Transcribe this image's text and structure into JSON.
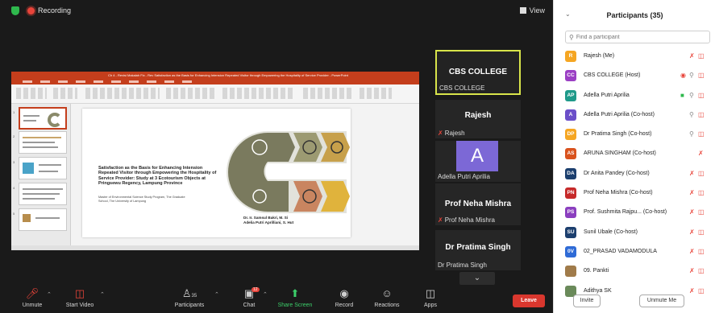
{
  "topbar": {
    "recording_label": "Recording",
    "view_label": "View"
  },
  "shared_screen": {
    "app_title": "Ch 4 - Revisi Makalah Fix - Rev Satisfaction as the Basis for Enhancing Intension Repeated Visitor through Empowering the Hospitality of Service Provider - PowerPoint",
    "slide_title": "Satisfaction as the Basis for Enhancing Intension Repeated Visitor through Empowering the Hospitality of Service Provider: Study at 3 Ecotourism Objects at Pringsewu Regency, Lampung Province",
    "slide_subtitle": "Master of Environmental Science Study Program, The Graduate School, The University of Lampung",
    "slide_authors": "Dr. Ir. Samsul Bakri, M. Si\nAdelia Putri Aprilliani, S. Hut"
  },
  "tiles": {
    "cbs": {
      "name": "CBS COLLEGE",
      "label": "CBS COLLEGE"
    },
    "rajesh": {
      "name": "Rajesh",
      "label": "Rajesh"
    },
    "adella": {
      "avatar": "A",
      "label": "Adella Putri Aprilia"
    },
    "neha": {
      "name": "Prof Neha Mishra",
      "label": "Prof Neha Mishra"
    },
    "pratima": {
      "name": "Dr Pratima Singh",
      "label": "Dr Pratima Singh"
    }
  },
  "toolbar": {
    "unmute": "Unmute",
    "start_video": "Start Video",
    "participants": "Participants",
    "participants_count": "35",
    "chat": "Chat",
    "chat_badge": "12",
    "share_screen": "Share Screen",
    "record": "Record",
    "reactions": "Reactions",
    "apps": "Apps",
    "leave": "Leave"
  },
  "panel": {
    "title": "Participants (35)",
    "search_placeholder": "Find a participant",
    "invite": "Invite",
    "unmute_me": "Unmute Me",
    "participants": [
      {
        "initials": "R",
        "color": "#f5a623",
        "name": "Rajesh (Me)",
        "icons": [
          "mic-off",
          "cam-off"
        ]
      },
      {
        "initials": "CC",
        "color": "#9b3fc4",
        "name": "CBS COLLEGE (Host)",
        "icons": [
          "share",
          "mic-on",
          "cam-off"
        ]
      },
      {
        "initials": "AP",
        "color": "#1f9a8a",
        "name": "Adella Putri Aprilia",
        "icons": [
          "cam-on",
          "mic-on",
          "cam-off"
        ]
      },
      {
        "initials": "A",
        "color": "#6b4fc9",
        "name": "Adella Putri Aprilia (Co-host)",
        "icons": [
          "mic-on",
          "cam-off"
        ]
      },
      {
        "initials": "DP",
        "color": "#f5a623",
        "name": "Dr Pratima Singh (Co-host)",
        "icons": [
          "mic-on",
          "cam-off"
        ]
      },
      {
        "initials": "AS",
        "color": "#d9531e",
        "name": "ARUNA SINGHAM (Co-host)",
        "icons": [
          "mic-off"
        ]
      },
      {
        "initials": "DA",
        "color": "#1c3f6e",
        "name": "Dr Anita Pandey (Co-host)",
        "icons": [
          "mic-off",
          "cam-off"
        ]
      },
      {
        "initials": "PN",
        "color": "#c62a2a",
        "name": "Prof Neha Mishra (Co-host)",
        "icons": [
          "mic-off",
          "cam-off"
        ]
      },
      {
        "initials": "PS",
        "color": "#8b3fbf",
        "name": "Prof. Sushmita Rajpu... (Co-host)",
        "icons": [
          "mic-off",
          "cam-off"
        ]
      },
      {
        "initials": "SU",
        "color": "#1c3f6e",
        "name": "Sunil Ubale (Co-host)",
        "icons": [
          "mic-off",
          "cam-off"
        ]
      },
      {
        "initials": "0V",
        "color": "#2f6bd6",
        "name": "02_PRASAD VADAMODULA",
        "icons": [
          "mic-off",
          "cam-off"
        ]
      },
      {
        "initials": "",
        "color": "#a07b4a",
        "name": "09. Pankti",
        "icons": [
          "mic-off",
          "cam-off"
        ]
      },
      {
        "initials": "",
        "color": "#6a8a5a",
        "name": "Adithya SK",
        "icons": [
          "mic-off",
          "cam-off"
        ]
      }
    ]
  },
  "colors": {
    "accent_green": "#3ccf6a",
    "leave_red": "#d9372e",
    "ppt_red": "#c43e1c",
    "active_speaker": "#d8e44a"
  }
}
